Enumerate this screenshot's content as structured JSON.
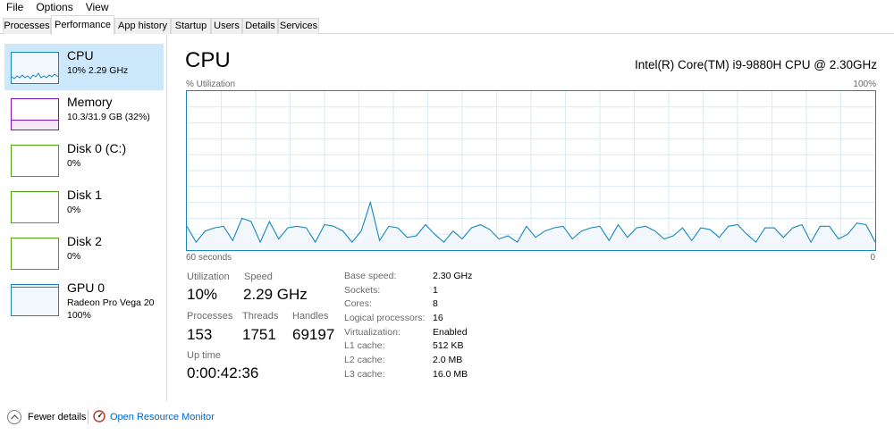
{
  "menu": [
    "File",
    "Options",
    "View"
  ],
  "tabs": [
    "Processes",
    "Performance",
    "App history",
    "Startup",
    "Users",
    "Details",
    "Services"
  ],
  "active_tab": "Performance",
  "sidebar": {
    "items": [
      {
        "name": "CPU",
        "sub": "10% 2.29 GHz",
        "color": "#1787be"
      },
      {
        "name": "Memory",
        "sub": "10.3/31.9 GB (32%)",
        "color": "#8b12ae"
      },
      {
        "name": "Disk 0 (C:)",
        "sub": "0%",
        "color": "#4da60c"
      },
      {
        "name": "Disk 1",
        "sub": "0%",
        "color": "#4da60c"
      },
      {
        "name": "Disk 2",
        "sub": "0%",
        "color": "#4da60c"
      },
      {
        "name": "GPU 0",
        "sub": "Radeon Pro Vega 20",
        "sub2": "100%",
        "color": "#1787be"
      }
    ]
  },
  "main": {
    "title": "CPU",
    "model": "Intel(R) Core(TM) i9-9880H CPU @ 2.30GHz",
    "graph": {
      "y_label": "% Utilization",
      "y_max_label": "100%",
      "x_label": "60 seconds",
      "x_min_label": "0"
    },
    "stats": {
      "utilization_label": "Utilization",
      "utilization": "10%",
      "speed_label": "Speed",
      "speed": "2.29 GHz",
      "processes_label": "Processes",
      "processes": "153",
      "threads_label": "Threads",
      "threads": "1751",
      "handles_label": "Handles",
      "handles": "69197",
      "uptime_label": "Up time",
      "uptime": "0:00:42:36"
    },
    "specs": [
      {
        "k": "Base speed:",
        "v": "2.30 GHz"
      },
      {
        "k": "Sockets:",
        "v": "1"
      },
      {
        "k": "Cores:",
        "v": "8"
      },
      {
        "k": "Logical processors:",
        "v": "16"
      },
      {
        "k": "Virtualization:",
        "v": "Enabled"
      },
      {
        "k": "L1 cache:",
        "v": "512 KB"
      },
      {
        "k": "L2 cache:",
        "v": "2.0 MB"
      },
      {
        "k": "L3 cache:",
        "v": "16.0 MB"
      }
    ]
  },
  "footer": {
    "fewer_details": "Fewer details",
    "resource_monitor": "Open Resource Monitor"
  },
  "chart_data": {
    "type": "area",
    "y_range": [
      0,
      100
    ],
    "x_range_seconds": [
      60,
      0
    ],
    "grid": true,
    "values": [
      15,
      5,
      12,
      14,
      15,
      6,
      20,
      18,
      5,
      18,
      7,
      14,
      15,
      14,
      5,
      16,
      15,
      12,
      5,
      12,
      30,
      6,
      15,
      14,
      8,
      9,
      16,
      10,
      5,
      12,
      7,
      14,
      16,
      13,
      7,
      9,
      5,
      15,
      8,
      12,
      14,
      15,
      7,
      12,
      14,
      15,
      6,
      16,
      8,
      14,
      15,
      12,
      7,
      9,
      14,
      6,
      14,
      13,
      8,
      15,
      16,
      10,
      5,
      14,
      14,
      8,
      14,
      16,
      5,
      15,
      15,
      7,
      10,
      17,
      16,
      5
    ]
  }
}
